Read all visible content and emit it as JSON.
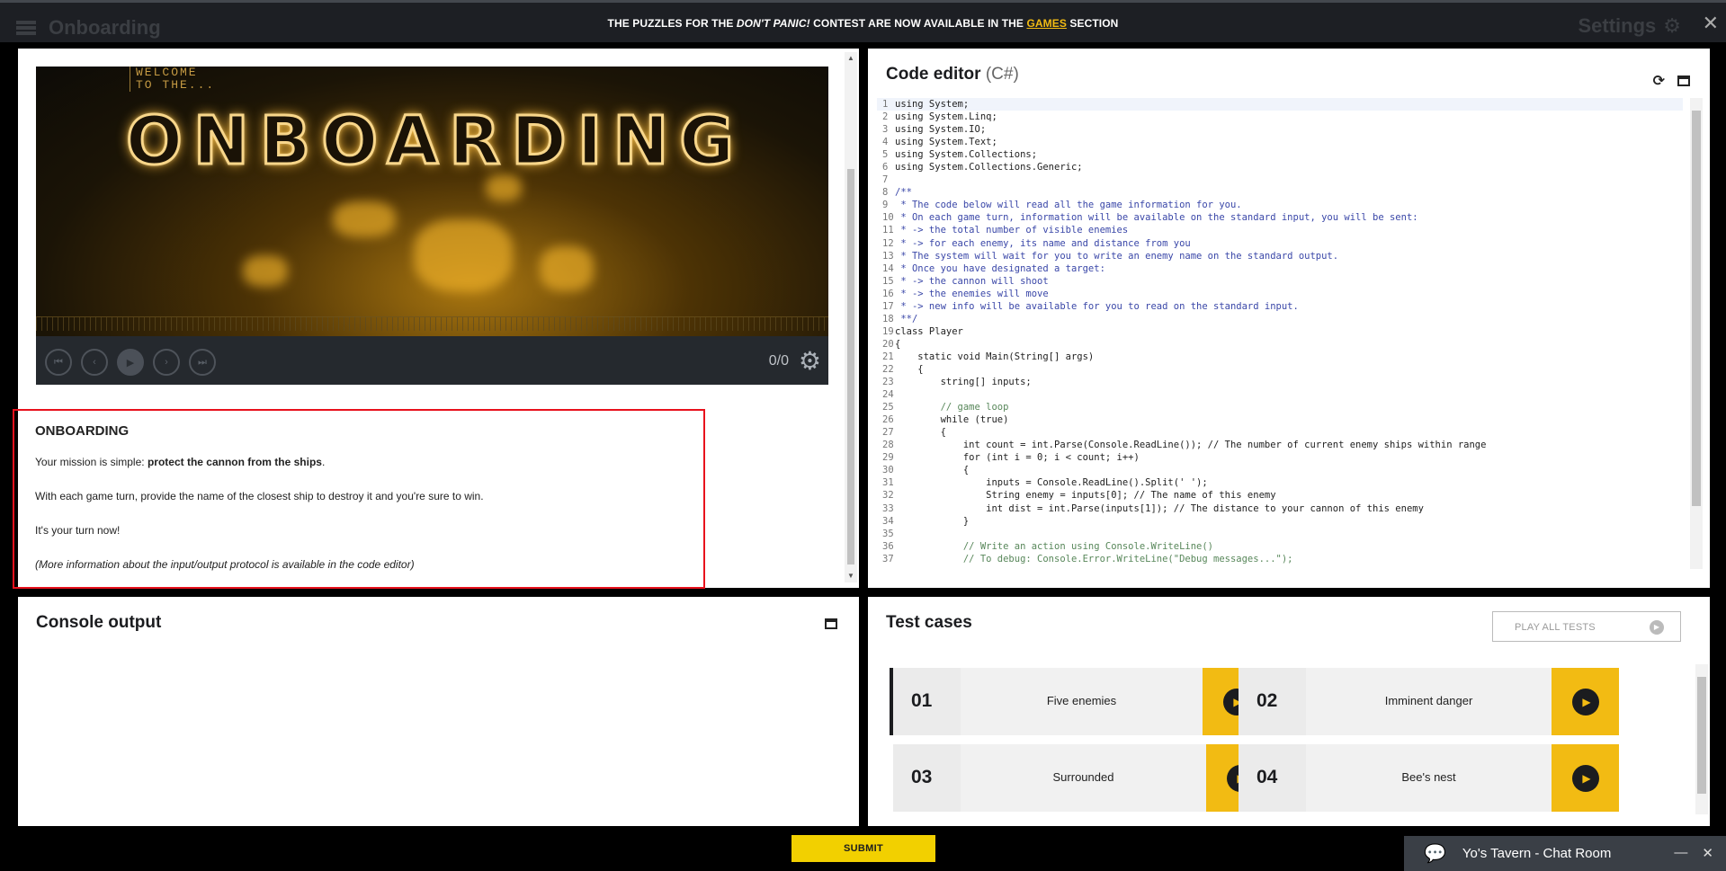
{
  "topbar": {
    "app_title": "Onboarding",
    "banner_pre": "THE PUZZLES FOR THE ",
    "banner_em": "DON'T PANIC!",
    "banner_mid": " CONTEST ARE NOW AVAILABLE IN THE ",
    "banner_link": "GAMES",
    "banner_post": " SECTION",
    "settings_label": "Settings",
    "close_glyph": "✕"
  },
  "statement": {
    "video": {
      "welcome_line1": "WELCOME",
      "welcome_line2": "TO THE...",
      "title": "ONBOARDING",
      "frame_count": "0/0"
    },
    "heading": "ONBOARDING",
    "p1_pre": "Your mission is simple: ",
    "p1_bold": "protect the cannon from the ships",
    "p1_post": ".",
    "p2": "With each game turn, provide the name of the closest ship to destroy it and you're sure to win.",
    "p3": "It's your turn now!",
    "p4": "(More information about the input/output protocol is available in the code editor)"
  },
  "editor": {
    "title": "Code editor",
    "language": " (C#)",
    "lines": [
      {
        "n": "1",
        "t": "using System;",
        "c": "tx"
      },
      {
        "n": "2",
        "t": "using System.Linq;",
        "c": "tx"
      },
      {
        "n": "3",
        "t": "using System.IO;",
        "c": "tx"
      },
      {
        "n": "4",
        "t": "using System.Text;",
        "c": "tx"
      },
      {
        "n": "5",
        "t": "using System.Collections;",
        "c": "tx"
      },
      {
        "n": "6",
        "t": "using System.Collections.Generic;",
        "c": "tx"
      },
      {
        "n": "7",
        "t": "",
        "c": "tx"
      },
      {
        "n": "8",
        "t": "/**",
        "c": "cmt"
      },
      {
        "n": "9",
        "t": " * The code below will read all the game information for you.",
        "c": "cmt"
      },
      {
        "n": "10",
        "t": " * On each game turn, information will be available on the standard input, you will be sent:",
        "c": "cmt"
      },
      {
        "n": "11",
        "t": " * -> the total number of visible enemies",
        "c": "cmt"
      },
      {
        "n": "12",
        "t": " * -> for each enemy, its name and distance from you",
        "c": "cmt"
      },
      {
        "n": "13",
        "t": " * The system will wait for you to write an enemy name on the standard output.",
        "c": "cmt"
      },
      {
        "n": "14",
        "t": " * Once you have designated a target:",
        "c": "cmt"
      },
      {
        "n": "15",
        "t": " * -> the cannon will shoot",
        "c": "cmt"
      },
      {
        "n": "16",
        "t": " * -> the enemies will move",
        "c": "cmt"
      },
      {
        "n": "17",
        "t": " * -> new info will be available for you to read on the standard input.",
        "c": "cmt"
      },
      {
        "n": "18",
        "t": " **/",
        "c": "cmt"
      },
      {
        "n": "19",
        "t": "class Player",
        "c": "tx"
      },
      {
        "n": "20",
        "t": "{",
        "c": "tx"
      },
      {
        "n": "21",
        "t": "    static void Main(String[] args)",
        "c": "tx"
      },
      {
        "n": "22",
        "t": "    {",
        "c": "tx"
      },
      {
        "n": "23",
        "t": "        string[] inputs;",
        "c": "tx"
      },
      {
        "n": "24",
        "t": "",
        "c": "tx"
      },
      {
        "n": "25",
        "t": "        // game loop",
        "c": "cmt2"
      },
      {
        "n": "26",
        "t": "        while (true)",
        "c": "tx"
      },
      {
        "n": "27",
        "t": "        {",
        "c": "tx"
      },
      {
        "n": "28",
        "t": "            int count = int.Parse(Console.ReadLine()); // The number of current enemy ships within range",
        "c": "tx"
      },
      {
        "n": "29",
        "t": "            for (int i = 0; i < count; i++)",
        "c": "tx"
      },
      {
        "n": "30",
        "t": "            {",
        "c": "tx"
      },
      {
        "n": "31",
        "t": "                inputs = Console.ReadLine().Split(' ');",
        "c": "tx"
      },
      {
        "n": "32",
        "t": "                String enemy = inputs[0]; // The name of this enemy",
        "c": "tx"
      },
      {
        "n": "33",
        "t": "                int dist = int.Parse(inputs[1]); // The distance to your cannon of this enemy",
        "c": "tx"
      },
      {
        "n": "34",
        "t": "            }",
        "c": "tx"
      },
      {
        "n": "35",
        "t": "",
        "c": "tx"
      },
      {
        "n": "36",
        "t": "            // Write an action using Console.WriteLine()",
        "c": "cmt2"
      },
      {
        "n": "37",
        "t": "            // To debug: Console.Error.WriteLine(\"Debug messages...\");",
        "c": "cmt2"
      }
    ]
  },
  "console": {
    "title": "Console output"
  },
  "tests": {
    "title": "Test cases",
    "play_all_label": "PLAY ALL TESTS",
    "cases": [
      {
        "num": "01",
        "name": "Five enemies"
      },
      {
        "num": "02",
        "name": "Imminent danger"
      },
      {
        "num": "03",
        "name": "Surrounded"
      },
      {
        "num": "04",
        "name": "Bee's nest"
      }
    ]
  },
  "submit_label": "SUBMIT",
  "chat": {
    "title": "Yo's Tavern - Chat Room"
  },
  "colors": {
    "accent": "#f2bb13",
    "highlight_border": "#e8111c",
    "background": "#000000"
  }
}
